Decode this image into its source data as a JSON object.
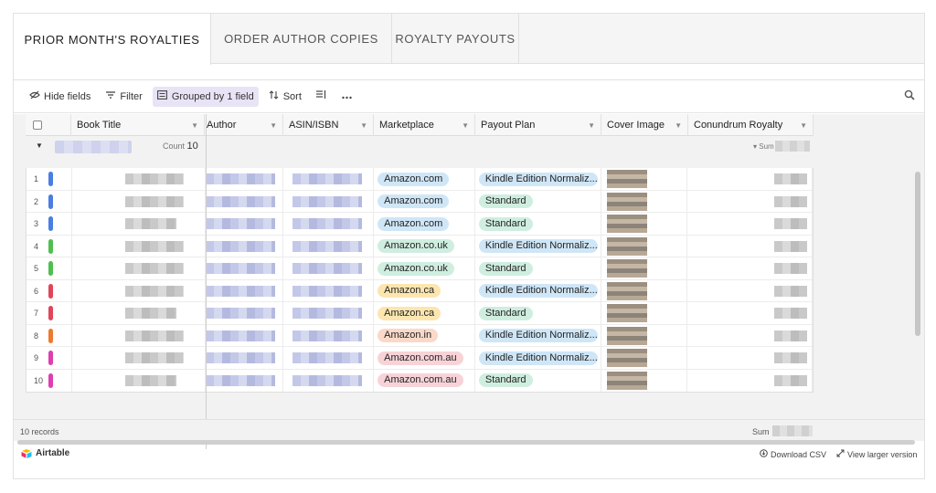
{
  "tabs": [
    {
      "label": "PRIOR MONTH'S ROYALTIES",
      "active": true
    },
    {
      "label": "ORDER AUTHOR COPIES",
      "active": false
    },
    {
      "label": "ROYALTY PAYOUTS",
      "active": false
    }
  ],
  "toolbar": {
    "hide_fields": "Hide fields",
    "filter": "Filter",
    "grouped": "Grouped by 1 field",
    "sort": "Sort"
  },
  "columns": [
    "Book Title",
    "Author",
    "ASIN/ISBN",
    "Marketplace",
    "Payout Plan",
    "Cover Image",
    "Conundrum Royalty"
  ],
  "group": {
    "count_label": "Count",
    "count": "10",
    "sum_label": "Sum"
  },
  "colors": {
    "blue": "#4a7ee3",
    "green": "#4fbf4f",
    "red": "#e0465a",
    "orange": "#ee7a2e",
    "pink": "#de3eb0",
    "pill_blue": "#cfe6f7",
    "pill_green": "#cfeee0",
    "pill_yellow": "#fbe6b0",
    "pill_peach": "#fad9c8",
    "pill_pink": "#f7d3d8"
  },
  "rows": [
    {
      "num": "1",
      "bar": "#4a7ee3",
      "market": "Amazon.com",
      "market_color": "#cfe6f7",
      "plan": "Kindle Edition Normaliz...",
      "plan_color": "#cfe6f7"
    },
    {
      "num": "2",
      "bar": "#4a7ee3",
      "market": "Amazon.com",
      "market_color": "#cfe6f7",
      "plan": "Standard",
      "plan_color": "#cfeee0"
    },
    {
      "num": "3",
      "bar": "#4a7ee3",
      "market": "Amazon.com",
      "market_color": "#cfe6f7",
      "plan": "Standard",
      "plan_color": "#cfeee0"
    },
    {
      "num": "4",
      "bar": "#4fbf4f",
      "market": "Amazon.co.uk",
      "market_color": "#cfeee0",
      "plan": "Kindle Edition Normaliz...",
      "plan_color": "#cfe6f7"
    },
    {
      "num": "5",
      "bar": "#4fbf4f",
      "market": "Amazon.co.uk",
      "market_color": "#cfeee0",
      "plan": "Standard",
      "plan_color": "#cfeee0"
    },
    {
      "num": "6",
      "bar": "#e0465a",
      "market": "Amazon.ca",
      "market_color": "#fbe6b0",
      "plan": "Kindle Edition Normaliz...",
      "plan_color": "#cfe6f7"
    },
    {
      "num": "7",
      "bar": "#e0465a",
      "market": "Amazon.ca",
      "market_color": "#fbe6b0",
      "plan": "Standard",
      "plan_color": "#cfeee0"
    },
    {
      "num": "8",
      "bar": "#ee7a2e",
      "market": "Amazon.in",
      "market_color": "#fad9c8",
      "plan": "Kindle Edition Normaliz...",
      "plan_color": "#cfe6f7"
    },
    {
      "num": "9",
      "bar": "#de3eb0",
      "market": "Amazon.com.au",
      "market_color": "#f7d3d8",
      "plan": "Kindle Edition Normaliz...",
      "plan_color": "#cfe6f7"
    },
    {
      "num": "10",
      "bar": "#de3eb0",
      "market": "Amazon.com.au",
      "market_color": "#f7d3d8",
      "plan": "Standard",
      "plan_color": "#cfeee0"
    }
  ],
  "footer": {
    "records": "10 records",
    "sum_label": "Sum"
  },
  "brand": {
    "name": "Airtable",
    "download": "Download CSV",
    "view_larger": "View larger version"
  }
}
